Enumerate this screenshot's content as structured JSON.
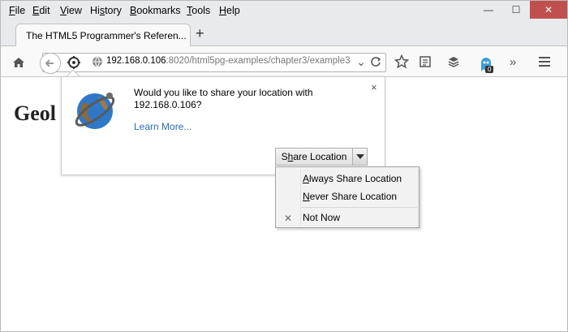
{
  "menubar": {
    "items": [
      {
        "label_acc": "F",
        "label_rest": "ile"
      },
      {
        "label_acc": "E",
        "label_rest": "dit"
      },
      {
        "label_acc": "V",
        "label_rest": "iew"
      },
      {
        "label_pre": "Hi",
        "label_acc": "s",
        "label_rest": "tory"
      },
      {
        "label_acc": "B",
        "label_rest": "ookmarks"
      },
      {
        "label_acc": "T",
        "label_rest": "ools"
      },
      {
        "label_acc": "H",
        "label_rest": "elp"
      }
    ],
    "minimize": "—",
    "maximize": "☐",
    "close": "✕"
  },
  "tab": {
    "title": "The HTML5 Programmer's Referen...",
    "new_tab": "+"
  },
  "urlbar": {
    "host": "192.168.0.106",
    "rest": ":8020/html5pg-examples/chapter3/example3"
  },
  "page": {
    "heading": "Geol"
  },
  "popup": {
    "message": "Would you like to share your location with 192.168.0.106?",
    "learn_more": "Learn More...",
    "close": "×",
    "share_pre": "S",
    "share_acc": "h",
    "share_rest": "are Location"
  },
  "dropdown": {
    "always_acc": "A",
    "always_rest": "lways Share Location",
    "never_acc": "N",
    "never_rest": "ever Share Location",
    "not_now": "Not Now",
    "x": "✕"
  },
  "badge": "0",
  "colors": {
    "close_button": "#c0504d",
    "link": "#2a6db5",
    "chrome": "#e9eaee"
  }
}
